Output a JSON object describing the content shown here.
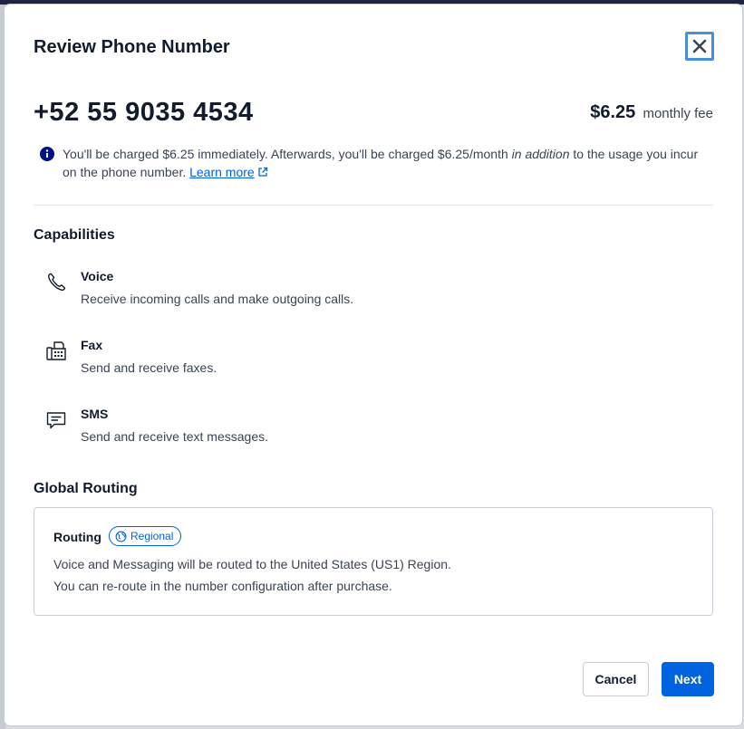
{
  "dialog": {
    "title": "Review Phone Number",
    "close_icon": "close-icon"
  },
  "number": {
    "display": "+52 55 9035 4534",
    "fee_amount": "$6.25",
    "fee_label": "monthly fee"
  },
  "notice": {
    "icon": "info-icon",
    "text_part1": "You'll be charged $6.25 immediately. Afterwards, you'll be charged $6.25/month ",
    "text_emphasis": "in addition",
    "text_part2": " to the usage you incur on the phone number. ",
    "link_label": "Learn more",
    "link_icon": "external-link-icon"
  },
  "capabilities": {
    "heading": "Capabilities",
    "items": [
      {
        "name": "Voice",
        "description": "Receive incoming calls and make outgoing calls.",
        "icon": "phone-icon"
      },
      {
        "name": "Fax",
        "description": "Send and receive faxes.",
        "icon": "fax-icon"
      },
      {
        "name": "SMS",
        "description": "Send and receive text messages.",
        "icon": "chat-icon"
      }
    ]
  },
  "global_routing": {
    "heading": "Global Routing",
    "label": "Routing",
    "badge": "Regional",
    "badge_icon": "globe-icon",
    "line1": "Voice and Messaging will be routed to the United States (US1) Region.",
    "line2": "You can re-route in the number configuration after purchase."
  },
  "footer": {
    "cancel_label": "Cancel",
    "next_label": "Next"
  },
  "colors": {
    "primary": "#0263e0",
    "text": "#121c2d",
    "focus_ring": "#4a8fdb",
    "info_icon": "#001489"
  }
}
